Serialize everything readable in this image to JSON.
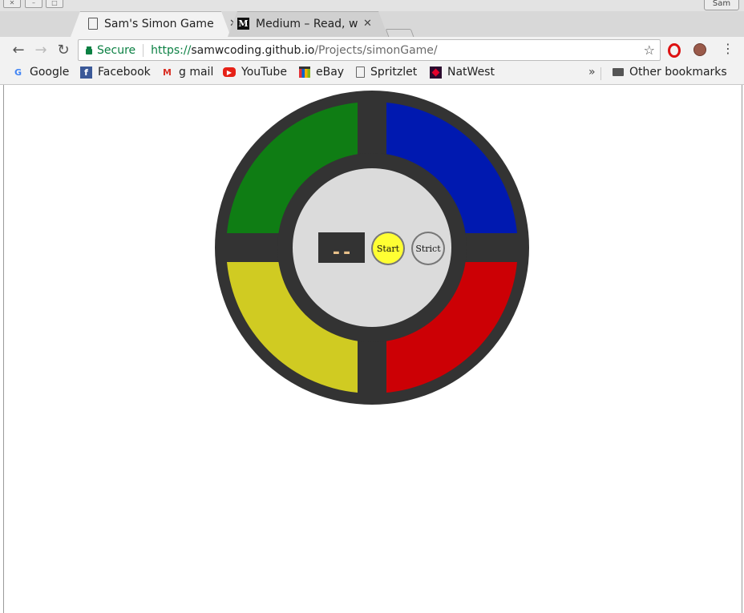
{
  "window": {
    "user_label": "Sam"
  },
  "tabs": [
    {
      "title": "Sam's Simon Game",
      "active": true,
      "icon": "page-icon"
    },
    {
      "title": "Medium – Read, wri",
      "active": false,
      "icon": "medium-icon",
      "icon_text": "M"
    }
  ],
  "toolbar": {
    "secure_label": "Secure",
    "url_scheme": "https://",
    "url_host": "samwcoding.github.io",
    "url_path": "/Projects/simonGame/"
  },
  "bookmarks": {
    "items": [
      {
        "label": "Google",
        "icon": "google-icon",
        "icon_text": "G",
        "color": "#4285f4"
      },
      {
        "label": "Facebook",
        "icon": "facebook-icon",
        "icon_text": "f",
        "color": "#3b5998"
      },
      {
        "label": "g mail",
        "icon": "gmail-icon",
        "icon_text": "M",
        "color": "#d93025"
      },
      {
        "label": "YouTube",
        "icon": "youtube-icon",
        "icon_text": "▶",
        "color": "#e62117"
      },
      {
        "label": "eBay",
        "icon": "ebay-icon",
        "icon_text": "",
        "color": "#333333"
      },
      {
        "label": "Spritzlet",
        "icon": "page-icon",
        "icon_text": "",
        "color": "#777777"
      },
      {
        "label": "NatWest",
        "icon": "natwest-icon",
        "icon_text": "",
        "color": "#5a1f5e"
      }
    ],
    "overflow_label": "»",
    "other_label": "Other bookmarks"
  },
  "game": {
    "count_display": "--",
    "start_label": "Start",
    "strict_label": "Strict",
    "colors": {
      "green": "#0f7d14",
      "blue": "#0019b0",
      "yellow": "#d0cb22",
      "red": "#cc0005",
      "body": "#333333",
      "center": "#dbdbdb",
      "start": "#ffff33",
      "counter_text": "#e8c08a"
    }
  }
}
